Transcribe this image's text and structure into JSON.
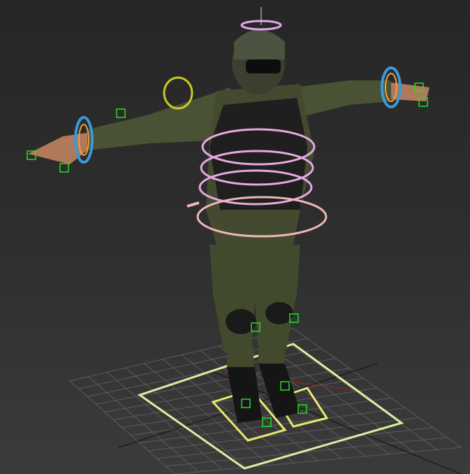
{
  "viewport": {
    "background_color": "#2e2e2e",
    "grid_color": "#5a5a5a",
    "grid_cells": 12
  },
  "rig_colors": {
    "spine_rings": "#e8a8e0",
    "pelvis_ring": "#f0b8b8",
    "wrist_rings": "#3a9ad8",
    "wrist_inner": "#f0a040",
    "shoulder_ring": "#c8c820",
    "head_ring": "#e0a8e8",
    "bone_boxes": "#20e020",
    "ground_controls": "#d8f0a0",
    "foot_controls": "#e8e870"
  },
  "icons": [
    "spine-control-icon",
    "wrist-control-icon",
    "shoulder-control-icon",
    "foot-control-icon",
    "root-control-icon"
  ]
}
